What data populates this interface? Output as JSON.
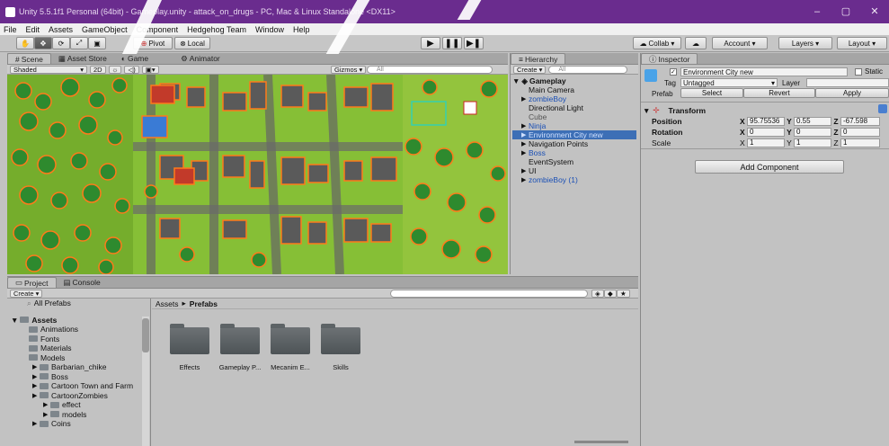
{
  "title": {
    "text": "Unity 5.5.1f1 Personal (64bit) - Gameplay.unity - attack_on_drugs - PC, Mac & Linux Standalone <DX11>",
    "minimize": "–",
    "maximize": "▢",
    "close": "✕"
  },
  "menu": [
    "File",
    "Edit",
    "Assets",
    "GameObject",
    "Component",
    "Hedgehog Team",
    "Window",
    "Help"
  ],
  "toolbar": {
    "pivot": "Pivot",
    "local": "Local",
    "collab": "Collab ▾",
    "account": "Account ▾",
    "layers": "Layers ▾",
    "layout": "Layout ▾"
  },
  "scene": {
    "tabs": [
      "Scene",
      "Asset Store",
      "Game",
      "Animator"
    ],
    "shading": "Shaded",
    "mode2d": "2D",
    "gizmos": "Gizmos ▾",
    "search_placeholder": "All"
  },
  "hierarchy": {
    "tab": "Hierarchy",
    "create": "Create ▾",
    "search_placeholder": "All",
    "root": "Gameplay",
    "items": [
      {
        "label": "Main Camera",
        "style": "normal",
        "arrow": false
      },
      {
        "label": "zombieBoy",
        "style": "blue",
        "arrow": true
      },
      {
        "label": "Directional Light",
        "style": "normal",
        "arrow": false
      },
      {
        "label": "Cube",
        "style": "gray",
        "arrow": false
      },
      {
        "label": "Ninja",
        "style": "blue",
        "arrow": true
      },
      {
        "label": "Environment City new",
        "style": "selected",
        "arrow": true
      },
      {
        "label": "Navigation Points",
        "style": "normal",
        "arrow": true
      },
      {
        "label": "Boss",
        "style": "blue",
        "arrow": true
      },
      {
        "label": "EventSystem",
        "style": "normal",
        "arrow": false
      },
      {
        "label": "UI",
        "style": "normal",
        "arrow": true
      },
      {
        "label": "zombieBoy (1)",
        "style": "blue",
        "arrow": true
      }
    ]
  },
  "inspector": {
    "tab": "Inspector",
    "object_name": "Environment City new",
    "static_label": "Static",
    "tag_label": "Tag",
    "tag_value": "Untagged",
    "layer_label": "Layer",
    "prefab_label": "Prefab",
    "select": "Select",
    "revert": "Revert",
    "apply": "Apply",
    "transform": "Transform",
    "position": {
      "label": "Position",
      "x": "95.75536",
      "y": "0.55",
      "z": "-67.598"
    },
    "rotation": {
      "label": "Rotation",
      "x": "0",
      "y": "0",
      "z": "0"
    },
    "scale": {
      "label": "Scale",
      "x": "1",
      "y": "1",
      "z": "1"
    },
    "add_component": "Add Component"
  },
  "project": {
    "tabs": [
      "Project",
      "Console"
    ],
    "create": "Create ▾",
    "favorites": [
      "All Prefabs"
    ],
    "assets_root": "Assets",
    "tree": [
      {
        "label": "Animations",
        "indent": 1
      },
      {
        "label": "Fonts",
        "indent": 1
      },
      {
        "label": "Materials",
        "indent": 1
      },
      {
        "label": "Models",
        "indent": 1
      },
      {
        "label": "Barbarian_chike",
        "indent": 2
      },
      {
        "label": "Boss",
        "indent": 2
      },
      {
        "label": "Cartoon Town and Farm",
        "indent": 2
      },
      {
        "label": "CartoonZombies",
        "indent": 2
      },
      {
        "label": "effect",
        "indent": 3
      },
      {
        "label": "models",
        "indent": 3
      },
      {
        "label": "Coins",
        "indent": 2
      }
    ],
    "breadcrumb_root": "Assets",
    "breadcrumb_sep": "▸",
    "breadcrumb_current": "Prefabs",
    "folders": [
      "Effects",
      "Gameplay P...",
      "Mecanim E...",
      "Skills"
    ]
  },
  "colors": {
    "titlebar": "#6a2c8e",
    "selection": "#3d6fb6",
    "scene_outline": "#ff7a1a"
  }
}
